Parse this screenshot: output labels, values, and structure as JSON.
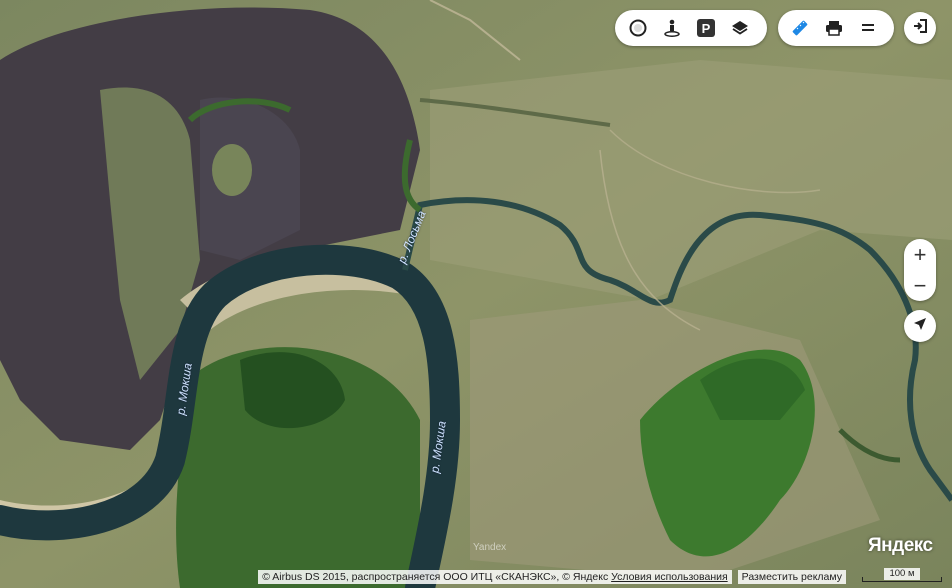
{
  "map": {
    "labels": {
      "moksha_1": "р. Мокша",
      "moksha_2": "р. Мокша",
      "losma": "р. Лосьма"
    },
    "watermark": "Yandex",
    "logo": "Яндекс"
  },
  "toolbar": {
    "traffic_icon": "traffic-icon",
    "panorama_icon": "panorama-person-icon",
    "parking_icon": "parking-icon",
    "parking_label": "P",
    "layers_icon": "layers-icon",
    "ruler_icon": "ruler-icon",
    "print_icon": "print-icon",
    "menu_icon": "menu-icon",
    "exit_icon": "exit-icon"
  },
  "controls": {
    "zoom_in": "+",
    "zoom_out": "−"
  },
  "footer": {
    "attribution": "© Airbus DS 2015, распространяется ООО ИТЦ «СКАНЭКС», © Яндекс",
    "terms": "Условия использования",
    "advertise": "Разместить рекламу",
    "scale": "100 м"
  },
  "colors": {
    "river": "#1f3a40",
    "burnt_field": "#3f3a40",
    "meadow": "#8a9560",
    "forest": "#3f7a2c",
    "sand": "#c9c0a0"
  }
}
